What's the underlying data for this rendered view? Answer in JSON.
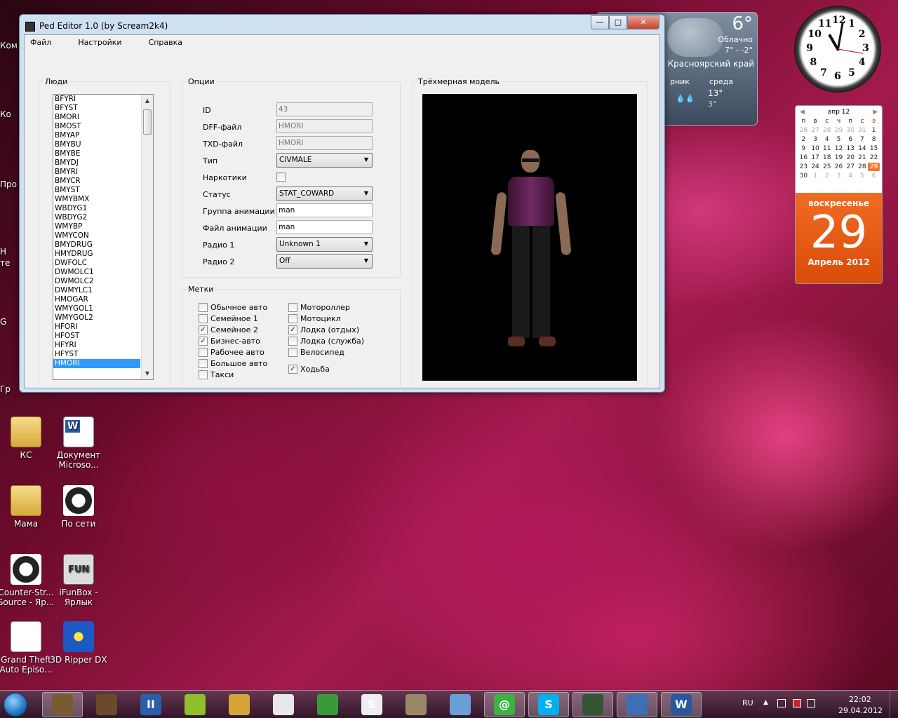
{
  "desktop": {
    "edge_labels": [
      "Ком",
      "Ко",
      "Про",
      "Н",
      "те",
      "G",
      "Гр"
    ],
    "icons": [
      {
        "label": "КС",
        "type": "folder"
      },
      {
        "label": "Документ Microso...",
        "type": "word"
      },
      {
        "label": "Мама",
        "type": "folder"
      },
      {
        "label": "По сети",
        "type": "cs"
      },
      {
        "label": "Counter-Str... Source - Яр...",
        "type": "cs"
      },
      {
        "label": "iFunBox - Ярлык",
        "type": "fun",
        "glyph": "FUN"
      },
      {
        "label": "Grand Theft Auto Episo...",
        "type": "gta"
      },
      {
        "label": "3D Ripper DX",
        "type": "x"
      }
    ]
  },
  "window": {
    "title": "Ped Editor 1.0 (by Scream2k4)",
    "minimize": "—",
    "maximize": "□",
    "close": "✕",
    "menu": [
      "Файл",
      "Настройки",
      "Справка"
    ],
    "people": {
      "label": "Люди",
      "items": [
        "BFYRI",
        "BFYST",
        "BMORI",
        "BMOST",
        "BMYAP",
        "BMYBU",
        "BMYBE",
        "BMYDJ",
        "BMYRI",
        "BMYCR",
        "BMYST",
        "WMYBMX",
        "WBDYG1",
        "WBDYG2",
        "WMYBP",
        "WMYCON",
        "BMYDRUG",
        "HMYDRUG",
        "DWFOLC",
        "DWMOLC1",
        "DWMOLC2",
        "DWMYLC1",
        "HMOGAR",
        "WMYGOL1",
        "WMYGOL2",
        "HFORI",
        "HFOST",
        "HFYRI",
        "HFYST",
        "HMORI"
      ],
      "selected": "HMORI",
      "up": "▲",
      "down": "▼"
    },
    "options": {
      "label": "Опции",
      "id_label": "ID",
      "id_value": "43",
      "dff_label": "DFF-файл",
      "dff_value": "HMORI",
      "txd_label": "TXD-файл",
      "txd_value": "HMORI",
      "type_label": "Тип",
      "type_value": "CIVMALE",
      "drugs_label": "Наркотики",
      "status_label": "Статус",
      "status_value": "STAT_COWARD",
      "animgroup_label": "Группа анимации",
      "animgroup_value": "man",
      "animfile_label": "Файл анимации",
      "animfile_value": "man",
      "radio1_label": "Радио 1",
      "radio1_value": "Unknown 1",
      "radio2_label": "Радио 2",
      "radio2_value": "Off",
      "arrow": "▼"
    },
    "flags": {
      "label": "Метки",
      "left": [
        {
          "label": "Обычное авто",
          "checked": false
        },
        {
          "label": "Семейное 1",
          "checked": false
        },
        {
          "label": "Семейное 2",
          "checked": true
        },
        {
          "label": "Бизнес-авто",
          "checked": true
        },
        {
          "label": "Рабочее авто",
          "checked": false
        },
        {
          "label": "Большое авто",
          "checked": false
        },
        {
          "label": "Такси",
          "checked": false
        }
      ],
      "right": [
        {
          "label": "Мотороллер",
          "checked": false
        },
        {
          "label": "Мотоцикл",
          "checked": false
        },
        {
          "label": "Лодка (отдых)",
          "checked": true
        },
        {
          "label": "Лодка (служба)",
          "checked": false
        },
        {
          "label": "Велосипед",
          "checked": false
        },
        {
          "label": "Ходьба",
          "checked": true
        }
      ],
      "check_glyph": "✓"
    },
    "model": {
      "label": "Трёхмерная модель"
    }
  },
  "weather": {
    "temp": "6°",
    "condition": "Облачно",
    "range": "7° - -2°",
    "region": "Красноярский край",
    "day1": "рник",
    "day2": "среда",
    "day2_hi": "13°",
    "day2_lo": "3°"
  },
  "clock": {
    "numbers": [
      "12",
      "1",
      "2",
      "3",
      "4",
      "5",
      "6",
      "7",
      "8",
      "9",
      "10",
      "11"
    ]
  },
  "calendar": {
    "month": "апр 12",
    "prev": "◀",
    "next": "▶",
    "weekdays": [
      "п",
      "в",
      "с",
      "ч",
      "п",
      "с",
      "в"
    ],
    "days": [
      {
        "d": "26",
        "m": true
      },
      {
        "d": "27",
        "m": true
      },
      {
        "d": "28",
        "m": true
      },
      {
        "d": "29",
        "m": true
      },
      {
        "d": "30",
        "m": true
      },
      {
        "d": "31",
        "m": true
      },
      {
        "d": "1"
      },
      {
        "d": "2"
      },
      {
        "d": "3"
      },
      {
        "d": "4"
      },
      {
        "d": "5"
      },
      {
        "d": "6"
      },
      {
        "d": "7"
      },
      {
        "d": "8"
      },
      {
        "d": "9"
      },
      {
        "d": "10"
      },
      {
        "d": "11"
      },
      {
        "d": "12"
      },
      {
        "d": "13"
      },
      {
        "d": "14"
      },
      {
        "d": "15"
      },
      {
        "d": "16"
      },
      {
        "d": "17"
      },
      {
        "d": "18"
      },
      {
        "d": "19"
      },
      {
        "d": "20"
      },
      {
        "d": "21"
      },
      {
        "d": "22"
      },
      {
        "d": "23"
      },
      {
        "d": "24"
      },
      {
        "d": "25"
      },
      {
        "d": "26"
      },
      {
        "d": "27"
      },
      {
        "d": "28"
      },
      {
        "d": "29",
        "t": true
      },
      {
        "d": "30"
      },
      {
        "d": "1",
        "m": true
      },
      {
        "d": "2",
        "m": true
      },
      {
        "d": "3",
        "m": true
      },
      {
        "d": "4",
        "m": true
      },
      {
        "d": "5",
        "m": true
      },
      {
        "d": "6",
        "m": true
      }
    ],
    "weekday": "воскресенье",
    "day": "29",
    "month_year": "Апрель 2012"
  },
  "taskbar": {
    "buttons": [
      {
        "name": "gta-sa",
        "active": true
      },
      {
        "name": "gta-sa-2"
      },
      {
        "name": "app-ii",
        "glyph": "II"
      },
      {
        "name": "app-green"
      },
      {
        "name": "app-pencil"
      },
      {
        "name": "app-window"
      },
      {
        "name": "chrome"
      },
      {
        "name": "app-s",
        "glyph": "S"
      },
      {
        "name": "app-image"
      },
      {
        "name": "app-stack"
      },
      {
        "name": "mail-at",
        "glyph": "@",
        "active": true
      },
      {
        "name": "skype",
        "glyph": "S",
        "active": true
      },
      {
        "name": "counter-strike",
        "active": true
      },
      {
        "name": "app-orb",
        "active": true
      },
      {
        "name": "word",
        "glyph": "W",
        "active": true
      }
    ],
    "lang": "RU",
    "time": "22:02",
    "date": "29.04.2012",
    "tray_arrow": "▲"
  }
}
